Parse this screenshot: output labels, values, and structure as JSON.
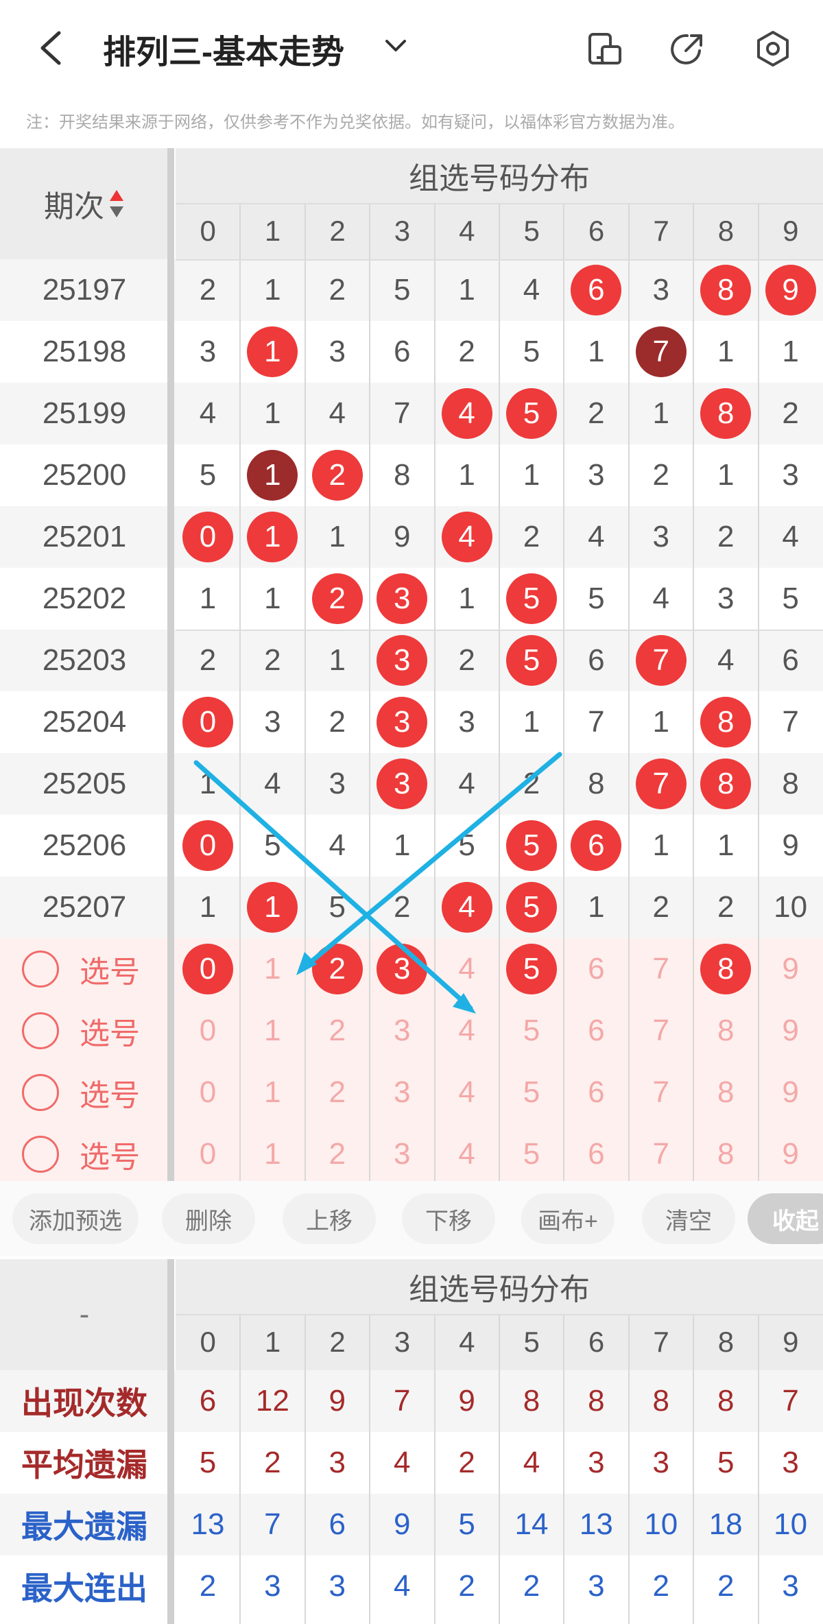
{
  "header": {
    "title": "排列三-基本走势",
    "icons": [
      "back-arrow",
      "chevron-down",
      "phone-screen",
      "share-external",
      "settings-hexagon"
    ]
  },
  "notice": "注：开奖结果来源于网络，仅供参考不作为兑奖依据。如有疑问，以福体彩官方数据为准。",
  "main_table": {
    "period_header": "期次",
    "distribution_header": "组选号码分布",
    "digits": [
      "0",
      "1",
      "2",
      "3",
      "4",
      "5",
      "6",
      "7",
      "8",
      "9"
    ],
    "rows": [
      {
        "period": "25197",
        "cells": [
          "2",
          "1",
          "2",
          "5",
          "1",
          "4",
          "6",
          "3",
          "8",
          "9"
        ],
        "hits": [
          6,
          8,
          9
        ],
        "dark": []
      },
      {
        "period": "25198",
        "cells": [
          "3",
          "1",
          "3",
          "6",
          "2",
          "5",
          "1",
          "7",
          "1",
          "1"
        ],
        "hits": [
          1,
          7
        ],
        "dark": [
          7
        ]
      },
      {
        "period": "25199",
        "cells": [
          "4",
          "1",
          "4",
          "7",
          "4",
          "5",
          "2",
          "1",
          "8",
          "2"
        ],
        "hits": [
          4,
          5,
          8
        ],
        "dark": []
      },
      {
        "period": "25200",
        "cells": [
          "5",
          "1",
          "2",
          "8",
          "1",
          "1",
          "3",
          "2",
          "1",
          "3"
        ],
        "hits": [
          1,
          2
        ],
        "dark": [
          1
        ]
      },
      {
        "period": "25201",
        "cells": [
          "0",
          "1",
          "1",
          "9",
          "4",
          "2",
          "4",
          "3",
          "2",
          "4"
        ],
        "hits": [
          0,
          1,
          4
        ],
        "dark": []
      },
      {
        "period": "25202",
        "cells": [
          "1",
          "1",
          "2",
          "3",
          "1",
          "5",
          "5",
          "4",
          "3",
          "5"
        ],
        "hits": [
          2,
          3,
          5
        ],
        "dark": []
      },
      {
        "period": "25203",
        "cells": [
          "2",
          "2",
          "1",
          "3",
          "2",
          "5",
          "6",
          "7",
          "4",
          "6"
        ],
        "hits": [
          3,
          5,
          7
        ],
        "dark": []
      },
      {
        "period": "25204",
        "cells": [
          "0",
          "3",
          "2",
          "3",
          "3",
          "1",
          "7",
          "1",
          "8",
          "7"
        ],
        "hits": [
          0,
          3,
          8
        ],
        "dark": []
      },
      {
        "period": "25205",
        "cells": [
          "1",
          "4",
          "3",
          "3",
          "4",
          "2",
          "8",
          "7",
          "8",
          "8"
        ],
        "hits": [
          3,
          7,
          8
        ],
        "dark": []
      },
      {
        "period": "25206",
        "cells": [
          "0",
          "5",
          "4",
          "1",
          "5",
          "5",
          "6",
          "1",
          "1",
          "9"
        ],
        "hits": [
          0,
          5,
          6
        ],
        "dark": []
      },
      {
        "period": "25207",
        "cells": [
          "1",
          "1",
          "5",
          "2",
          "4",
          "5",
          "1",
          "2",
          "2",
          "10"
        ],
        "hits": [
          1,
          4,
          5
        ],
        "dark": []
      }
    ],
    "selection_rows": [
      {
        "label": "选号",
        "selected": [
          0,
          2,
          3,
          5,
          8
        ]
      },
      {
        "label": "选号",
        "selected": []
      },
      {
        "label": "选号",
        "selected": []
      },
      {
        "label": "选号",
        "selected": []
      }
    ]
  },
  "toolbar": {
    "buttons": [
      "添加预选",
      "删除",
      "上移",
      "下移",
      "画布+",
      "清空"
    ],
    "collapse": "收起"
  },
  "stats_table": {
    "corner": "-",
    "distribution_header": "组选号码分布",
    "rows": [
      {
        "label": "出现次数",
        "color": "#a52a2a",
        "values": [
          "6",
          "12",
          "9",
          "7",
          "9",
          "8",
          "8",
          "8",
          "8",
          "7"
        ]
      },
      {
        "label": "平均遗漏",
        "color": "#a52a2a",
        "values": [
          "5",
          "2",
          "3",
          "4",
          "2",
          "4",
          "3",
          "3",
          "5",
          "3"
        ]
      },
      {
        "label": "最大遗漏",
        "color": "#2b62c9",
        "values": [
          "13",
          "7",
          "6",
          "9",
          "5",
          "14",
          "13",
          "10",
          "18",
          "10"
        ]
      },
      {
        "label": "最大连出",
        "color": "#2b62c9",
        "values": [
          "2",
          "3",
          "3",
          "4",
          "2",
          "2",
          "3",
          "2",
          "2",
          "3"
        ]
      }
    ]
  },
  "colors": {
    "ball_red": "#ee3a3a",
    "ball_dark": "#9c2b2b",
    "selection_bg": "#fdf0ee",
    "annotation_line": "#1fb1e3"
  }
}
